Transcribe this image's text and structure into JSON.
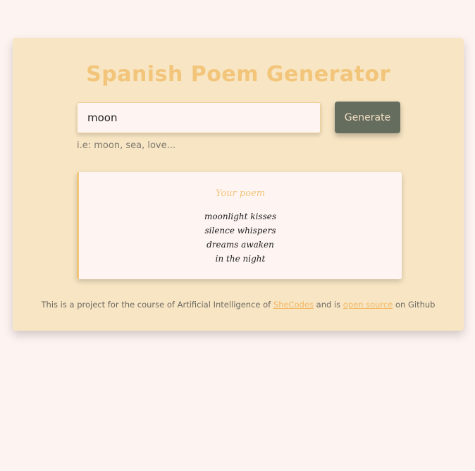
{
  "header": {
    "title": "Spanish Poem Generator"
  },
  "form": {
    "input_value": "moon",
    "generate_label": "Generate",
    "hint": "i.e: moon, sea, love..."
  },
  "poem": {
    "heading": "Your poem",
    "lines": [
      "moonlight kisses",
      "silence whispers",
      "dreams awaken",
      "in the night"
    ]
  },
  "footer": {
    "text_before": "This is a project for the course of Artificial Intelligence of ",
    "link1": "SheCodes",
    "text_middle": " and is ",
    "link2": "open source",
    "text_after": " on Github"
  },
  "colors": {
    "page_bg": "#fdf3f1",
    "card_bg": "#f7e5c3",
    "accent": "#f2c57a",
    "button_bg": "#646d5e"
  }
}
